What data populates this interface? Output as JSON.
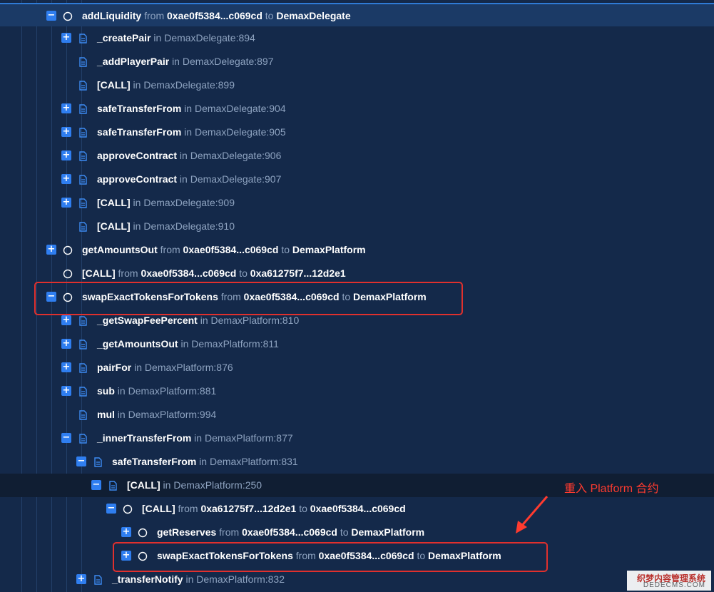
{
  "rows": [
    {
      "id": "r0",
      "name": "addLiquidity",
      "from_word": "from",
      "from": "0xae0f5384...c069cd",
      "to_word": "to",
      "to": "DemaxDelegate"
    },
    {
      "id": "r1",
      "name": "_createPair",
      "in_word": "in",
      "loc": "DemaxDelegate:894"
    },
    {
      "id": "r2",
      "name": "_addPlayerPair",
      "in_word": "in",
      "loc": "DemaxDelegate:897"
    },
    {
      "id": "r3",
      "name": "[CALL]",
      "in_word": "in",
      "loc": "DemaxDelegate:899"
    },
    {
      "id": "r4",
      "name": "safeTransferFrom",
      "in_word": "in",
      "loc": "DemaxDelegate:904"
    },
    {
      "id": "r5",
      "name": "safeTransferFrom",
      "in_word": "in",
      "loc": "DemaxDelegate:905"
    },
    {
      "id": "r6",
      "name": "approveContract",
      "in_word": "in",
      "loc": "DemaxDelegate:906"
    },
    {
      "id": "r7",
      "name": "approveContract",
      "in_word": "in",
      "loc": "DemaxDelegate:907"
    },
    {
      "id": "r8",
      "name": "[CALL]",
      "in_word": "in",
      "loc": "DemaxDelegate:909"
    },
    {
      "id": "r9",
      "name": "[CALL]",
      "in_word": "in",
      "loc": "DemaxDelegate:910"
    },
    {
      "id": "r10",
      "name": "getAmountsOut",
      "from_word": "from",
      "from": "0xae0f5384...c069cd",
      "to_word": "to",
      "to": "DemaxPlatform"
    },
    {
      "id": "r11",
      "name": "[CALL]",
      "from_word": "from",
      "from": "0xae0f5384...c069cd",
      "to_word": "to",
      "to": "0xa61275f7...12d2e1"
    },
    {
      "id": "r12",
      "name": "swapExactTokensForTokens",
      "from_word": "from",
      "from": "0xae0f5384...c069cd",
      "to_word": "to",
      "to": "DemaxPlatform"
    },
    {
      "id": "r13",
      "name": "_getSwapFeePercent",
      "in_word": "in",
      "loc": "DemaxPlatform:810"
    },
    {
      "id": "r14",
      "name": "_getAmountsOut",
      "in_word": "in",
      "loc": "DemaxPlatform:811"
    },
    {
      "id": "r15",
      "name": "pairFor",
      "in_word": "in",
      "loc": "DemaxPlatform:876"
    },
    {
      "id": "r16",
      "name": "sub",
      "in_word": "in",
      "loc": "DemaxPlatform:881"
    },
    {
      "id": "r17",
      "name": "mul",
      "in_word": "in",
      "loc": "DemaxPlatform:994"
    },
    {
      "id": "r18",
      "name": "_innerTransferFrom",
      "in_word": "in",
      "loc": "DemaxPlatform:877"
    },
    {
      "id": "r19",
      "name": "safeTransferFrom",
      "in_word": "in",
      "loc": "DemaxPlatform:831"
    },
    {
      "id": "r20",
      "name": "[CALL]",
      "in_word": "in",
      "loc": "DemaxPlatform:250"
    },
    {
      "id": "r21",
      "name": "[CALL]",
      "from_word": "from",
      "from": "0xa61275f7...12d2e1",
      "to_word": "to",
      "to": "0xae0f5384...c069cd"
    },
    {
      "id": "r22",
      "name": "getReserves",
      "from_word": "from",
      "from": "0xae0f5384...c069cd",
      "to_word": "to",
      "to": "DemaxPlatform"
    },
    {
      "id": "r23",
      "name": "swapExactTokensForTokens",
      "from_word": "from",
      "from": "0xae0f5384...c069cd",
      "to_word": "to",
      "to": "DemaxPlatform"
    },
    {
      "id": "r24",
      "name": "_transferNotify",
      "in_word": "in",
      "loc": "DemaxPlatform:832"
    }
  ],
  "annotation": {
    "text": "重入 Platform 合约"
  },
  "watermark": {
    "line1": "织梦内容管理系统",
    "line2": "DEDECMS.COM"
  },
  "colors": {
    "background": "#14294a",
    "toggle": "#2f7ef0",
    "highlight": "#e0302d",
    "annotation": "#ff3b2f"
  }
}
